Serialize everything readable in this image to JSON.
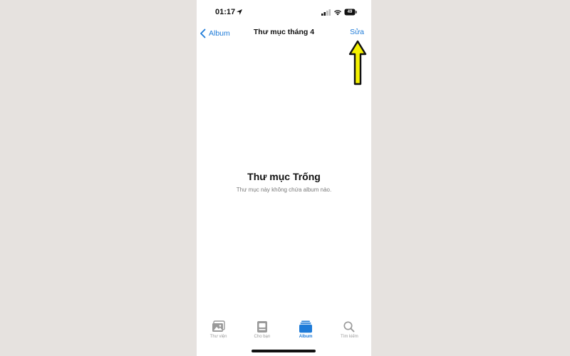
{
  "status_bar": {
    "time": "01:17",
    "battery": "49"
  },
  "nav": {
    "back_label": "Album",
    "title": "Thư mục tháng 4",
    "edit_label": "Sửa"
  },
  "empty_state": {
    "title": "Thư mục Trống",
    "subtitle": "Thư mục này không chứa album nào."
  },
  "tabs": [
    {
      "label": "Thư viện",
      "icon": "photo-library-icon",
      "active": false
    },
    {
      "label": "Cho bạn",
      "icon": "for-you-icon",
      "active": false
    },
    {
      "label": "Album",
      "icon": "albums-icon",
      "active": true
    },
    {
      "label": "Tìm kiếm",
      "icon": "search-icon",
      "active": false
    }
  ],
  "colors": {
    "accent": "#1e7bd8",
    "annotation": "#f5f100",
    "background": "#e6e2df"
  }
}
